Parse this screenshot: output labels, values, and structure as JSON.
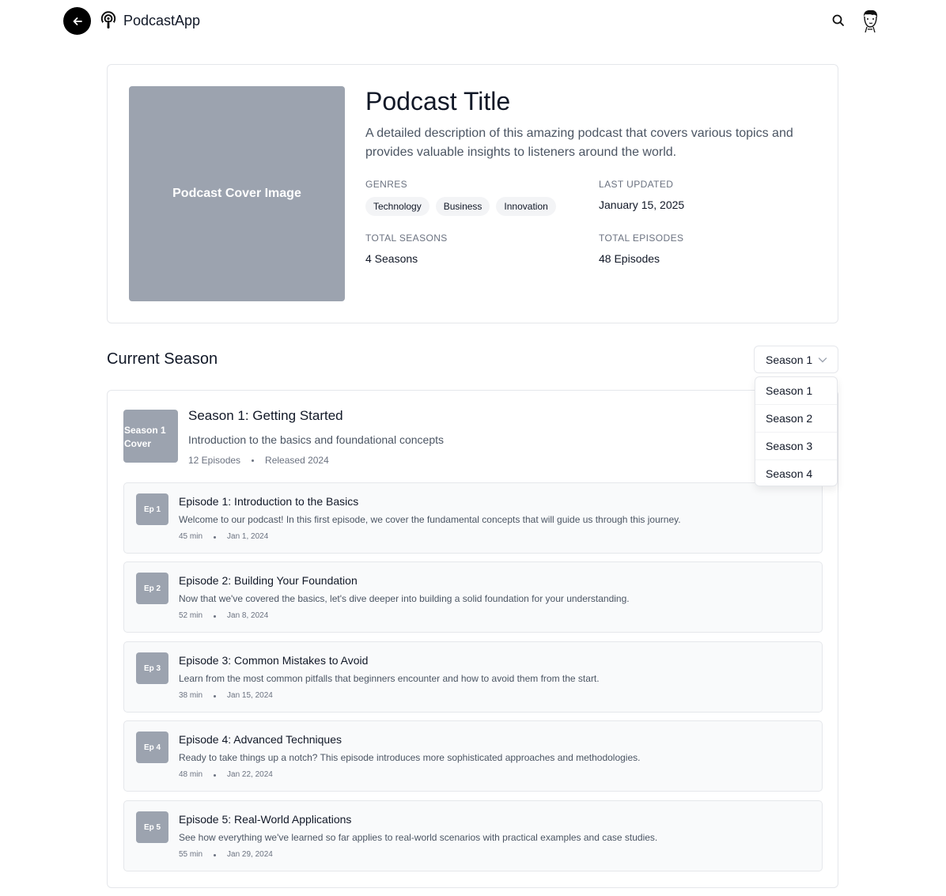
{
  "header": {
    "app_name": "PodcastApp"
  },
  "podcast": {
    "cover_label": "Podcast Cover Image",
    "title": "Podcast Title",
    "description": "A detailed description of this amazing podcast that covers various topics and provides valuable insights to listeners around the world.",
    "genres_label": "Genres",
    "genres": [
      "Technology",
      "Business",
      "Innovation"
    ],
    "last_updated_label": "Last Updated",
    "last_updated": "January 15, 2025",
    "total_seasons_label": "Total Seasons",
    "total_seasons": "4 Seasons",
    "total_episodes_label": "Total Episodes",
    "total_episodes": "48 Episodes"
  },
  "season_section": {
    "title": "Current Season",
    "selected": "Season 1",
    "options": [
      "Season 1",
      "Season 2",
      "Season 3",
      "Season 4"
    ]
  },
  "season": {
    "cover_label": "Season 1 Cover",
    "name": "Season 1: Getting Started",
    "description": "Introduction to the basics and foundational concepts",
    "episodes_count": "12 Episodes",
    "released": "Released 2024"
  },
  "episodes": [
    {
      "badge": "Ep 1",
      "title": "Episode 1: Introduction to the Basics",
      "description": "Welcome to our podcast! In this first episode, we cover the fundamental concepts that will guide us through this journey.",
      "duration": "45 min",
      "date": "Jan 1, 2024"
    },
    {
      "badge": "Ep 2",
      "title": "Episode 2: Building Your Foundation",
      "description": "Now that we've covered the basics, let's dive deeper into building a solid foundation for your understanding.",
      "duration": "52 min",
      "date": "Jan 8, 2024"
    },
    {
      "badge": "Ep 3",
      "title": "Episode 3: Common Mistakes to Avoid",
      "description": "Learn from the most common pitfalls that beginners encounter and how to avoid them from the start.",
      "duration": "38 min",
      "date": "Jan 15, 2024"
    },
    {
      "badge": "Ep 4",
      "title": "Episode 4: Advanced Techniques",
      "description": "Ready to take things up a notch? This episode introduces more sophisticated approaches and methodologies.",
      "duration": "48 min",
      "date": "Jan 22, 2024"
    },
    {
      "badge": "Ep 5",
      "title": "Episode 5: Real-World Applications",
      "description": "See how everything we've learned so far applies to real-world scenarios with practical examples and case studies.",
      "duration": "55 min",
      "date": "Jan 29, 2024"
    }
  ]
}
